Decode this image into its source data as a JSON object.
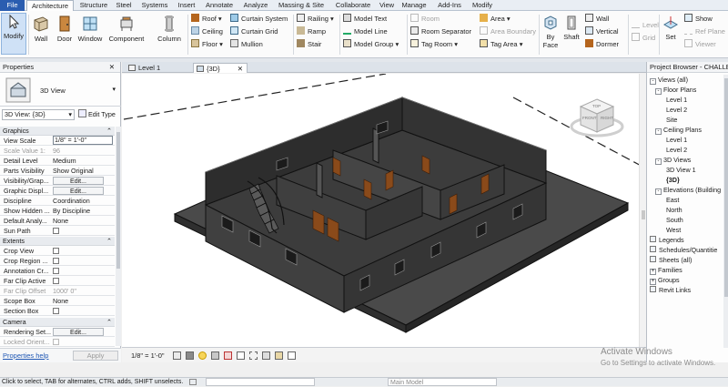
{
  "ribbon_tabs": [
    "File",
    "Architecture",
    "Structure",
    "Steel",
    "Systems",
    "Insert",
    "Annotate",
    "Analyze",
    "Massing & Site",
    "Collaborate",
    "View",
    "Manage",
    "Add-Ins",
    "Modify"
  ],
  "ribbon": {
    "modify": "Modify",
    "wall": "Wall",
    "door": "Door",
    "window": "Window",
    "component": "Component",
    "column": "Column",
    "roof": "Roof",
    "ceiling": "Ceiling",
    "floor": "Floor",
    "curtain_system": "Curtain System",
    "curtain_grid": "Curtain Grid",
    "mullion": "Mullion",
    "railing": "Railing",
    "ramp": "Ramp",
    "stair": "Stair",
    "model_text": "Model Text",
    "model_line": "Model Line",
    "model_group": "Model Group",
    "room": "Room",
    "room_separator": "Room Separator",
    "tag_room": "Tag Room",
    "area": "Area",
    "area_boundary": "Area Boundary",
    "tag_area": "Tag Area",
    "by_face": "By Face",
    "shaft": "Shaft",
    "wall2": "Wall",
    "vertical": "Vertical",
    "dormer": "Dormer",
    "level": "Level",
    "grid": "Grid",
    "set": "Set",
    "show": "Show",
    "ref_plane": "Ref Plane",
    "viewer": "Viewer"
  },
  "properties": {
    "title": "Properties",
    "type_name": "3D View",
    "selector": "3D View: {3D}",
    "edit_type": "Edit Type",
    "groups": {
      "graphics": "Graphics",
      "extents": "Extents",
      "camera": "Camera"
    },
    "rows": {
      "view_scale": {
        "k": "View Scale",
        "v": "1/8\" = 1'-0\""
      },
      "scale_value": {
        "k": "Scale Value    1:",
        "v": "96"
      },
      "detail_level": {
        "k": "Detail Level",
        "v": "Medium"
      },
      "parts_visibility": {
        "k": "Parts Visibility",
        "v": "Show Original"
      },
      "visibility_graphics": {
        "k": "Visibility/Grap...",
        "v": "Edit..."
      },
      "graphic_display": {
        "k": "Graphic Displ...",
        "v": "Edit..."
      },
      "discipline": {
        "k": "Discipline",
        "v": "Coordination"
      },
      "show_hidden": {
        "k": "Show Hidden ...",
        "v": "By Discipline"
      },
      "default_analysis": {
        "k": "Default Analy...",
        "v": "None"
      },
      "sun_path": {
        "k": "Sun Path",
        "v": ""
      },
      "crop_view": {
        "k": "Crop View",
        "v": ""
      },
      "crop_region": {
        "k": "Crop Region ...",
        "v": ""
      },
      "annotation_crop": {
        "k": "Annotation Cr...",
        "v": ""
      },
      "far_clip_active": {
        "k": "Far Clip Active",
        "v": ""
      },
      "far_clip_offset": {
        "k": "Far Clip Offset",
        "v": "1000'  0\""
      },
      "scope_box": {
        "k": "Scope Box",
        "v": "None"
      },
      "section_box": {
        "k": "Section Box",
        "v": ""
      },
      "rendering_settings": {
        "k": "Rendering Set...",
        "v": "Edit..."
      },
      "locked_orientation": {
        "k": "Locked Orient...",
        "v": ""
      }
    },
    "help_link": "Properties help",
    "apply": "Apply"
  },
  "view_tabs": [
    "Level 1",
    "{3D}"
  ],
  "view_scale_label": "1/8\" = 1'-0\"",
  "browser": {
    "title": "Project Browser - CHALLEN",
    "nodes": [
      {
        "label": "Views (all)",
        "indent": 0,
        "tw": "-"
      },
      {
        "label": "Floor Plans",
        "indent": 1,
        "tw": "-"
      },
      {
        "label": "Level 1",
        "indent": 3,
        "tw": ""
      },
      {
        "label": "Level 2",
        "indent": 3,
        "tw": ""
      },
      {
        "label": "Site",
        "indent": 3,
        "tw": ""
      },
      {
        "label": "Ceiling Plans",
        "indent": 1,
        "tw": "-"
      },
      {
        "label": "Level 1",
        "indent": 3,
        "tw": ""
      },
      {
        "label": "Level 2",
        "indent": 3,
        "tw": ""
      },
      {
        "label": "3D Views",
        "indent": 1,
        "tw": "-"
      },
      {
        "label": "3D View 1",
        "indent": 3,
        "tw": ""
      },
      {
        "label": "{3D}",
        "indent": 3,
        "tw": "",
        "bold": true
      },
      {
        "label": "Elevations (Building",
        "indent": 1,
        "tw": "-"
      },
      {
        "label": "East",
        "indent": 3,
        "tw": ""
      },
      {
        "label": "North",
        "indent": 3,
        "tw": ""
      },
      {
        "label": "South",
        "indent": 3,
        "tw": ""
      },
      {
        "label": "West",
        "indent": 3,
        "tw": ""
      },
      {
        "label": "Legends",
        "indent": 0,
        "tw": ""
      },
      {
        "label": "Schedules/Quantitie",
        "indent": 0,
        "tw": ""
      },
      {
        "label": "Sheets (all)",
        "indent": 0,
        "tw": ""
      },
      {
        "label": "Families",
        "indent": 0,
        "tw": "+"
      },
      {
        "label": "Groups",
        "indent": 0,
        "tw": "+"
      },
      {
        "label": "Revit Links",
        "indent": 0,
        "tw": ""
      }
    ]
  },
  "status": {
    "hint": "Click to select, TAB for alternates, CTRL adds, SHIFT unselects.",
    "model": "Main Model"
  },
  "activate": {
    "title": "Activate Windows",
    "sub": "Go to Settings to activate Windows."
  },
  "viewcube": {
    "front": "FRONT",
    "right": "RIGHT",
    "top": "TOP"
  }
}
